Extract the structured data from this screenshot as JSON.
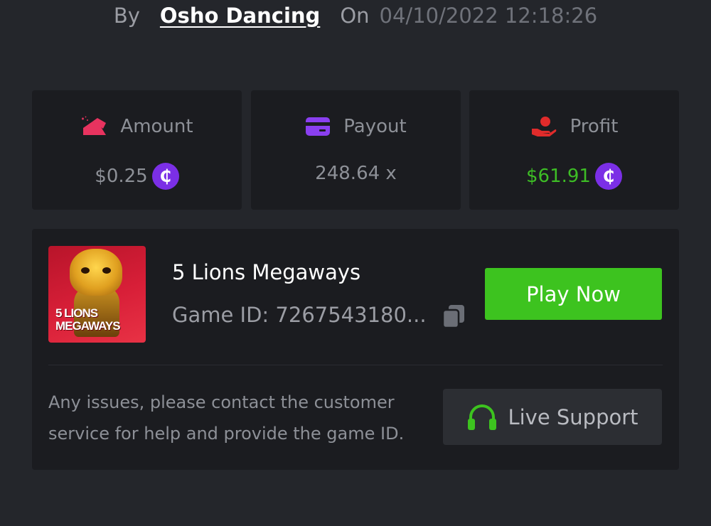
{
  "header": {
    "by_label": "By",
    "username": "Osho Dancing",
    "on_label": "On",
    "timestamp": "04/10/2022 12:18:26"
  },
  "stats": {
    "amount": {
      "label": "Amount",
      "value": "$0.25",
      "icon": "amount-icon",
      "color": "#e8335f"
    },
    "payout": {
      "label": "Payout",
      "value": "248.64 x",
      "icon": "card-icon",
      "color": "#8a3ff0"
    },
    "profit": {
      "label": "Profit",
      "value": "$61.91",
      "icon": "hand-coin-icon",
      "color": "#e02b2b",
      "value_color": "#3dbd25"
    },
    "currency_symbol": "₵"
  },
  "game": {
    "title": "5 Lions Megaways",
    "id_text": "Game ID: 7267543180...",
    "thumbnail_text_line1": "5 LIONS",
    "thumbnail_text_line2": "MEGAWAYS",
    "play_label": "Play Now"
  },
  "support": {
    "help_text": "Any issues, please contact the customer service for help and provide the game ID.",
    "button_label": "Live Support",
    "icon": "headset-icon",
    "icon_color": "#3dc31f"
  },
  "colors": {
    "background": "#24262b",
    "card": "#1b1c20",
    "accent_green": "#3dc31f",
    "coin_purple": "#7b2fe6"
  }
}
